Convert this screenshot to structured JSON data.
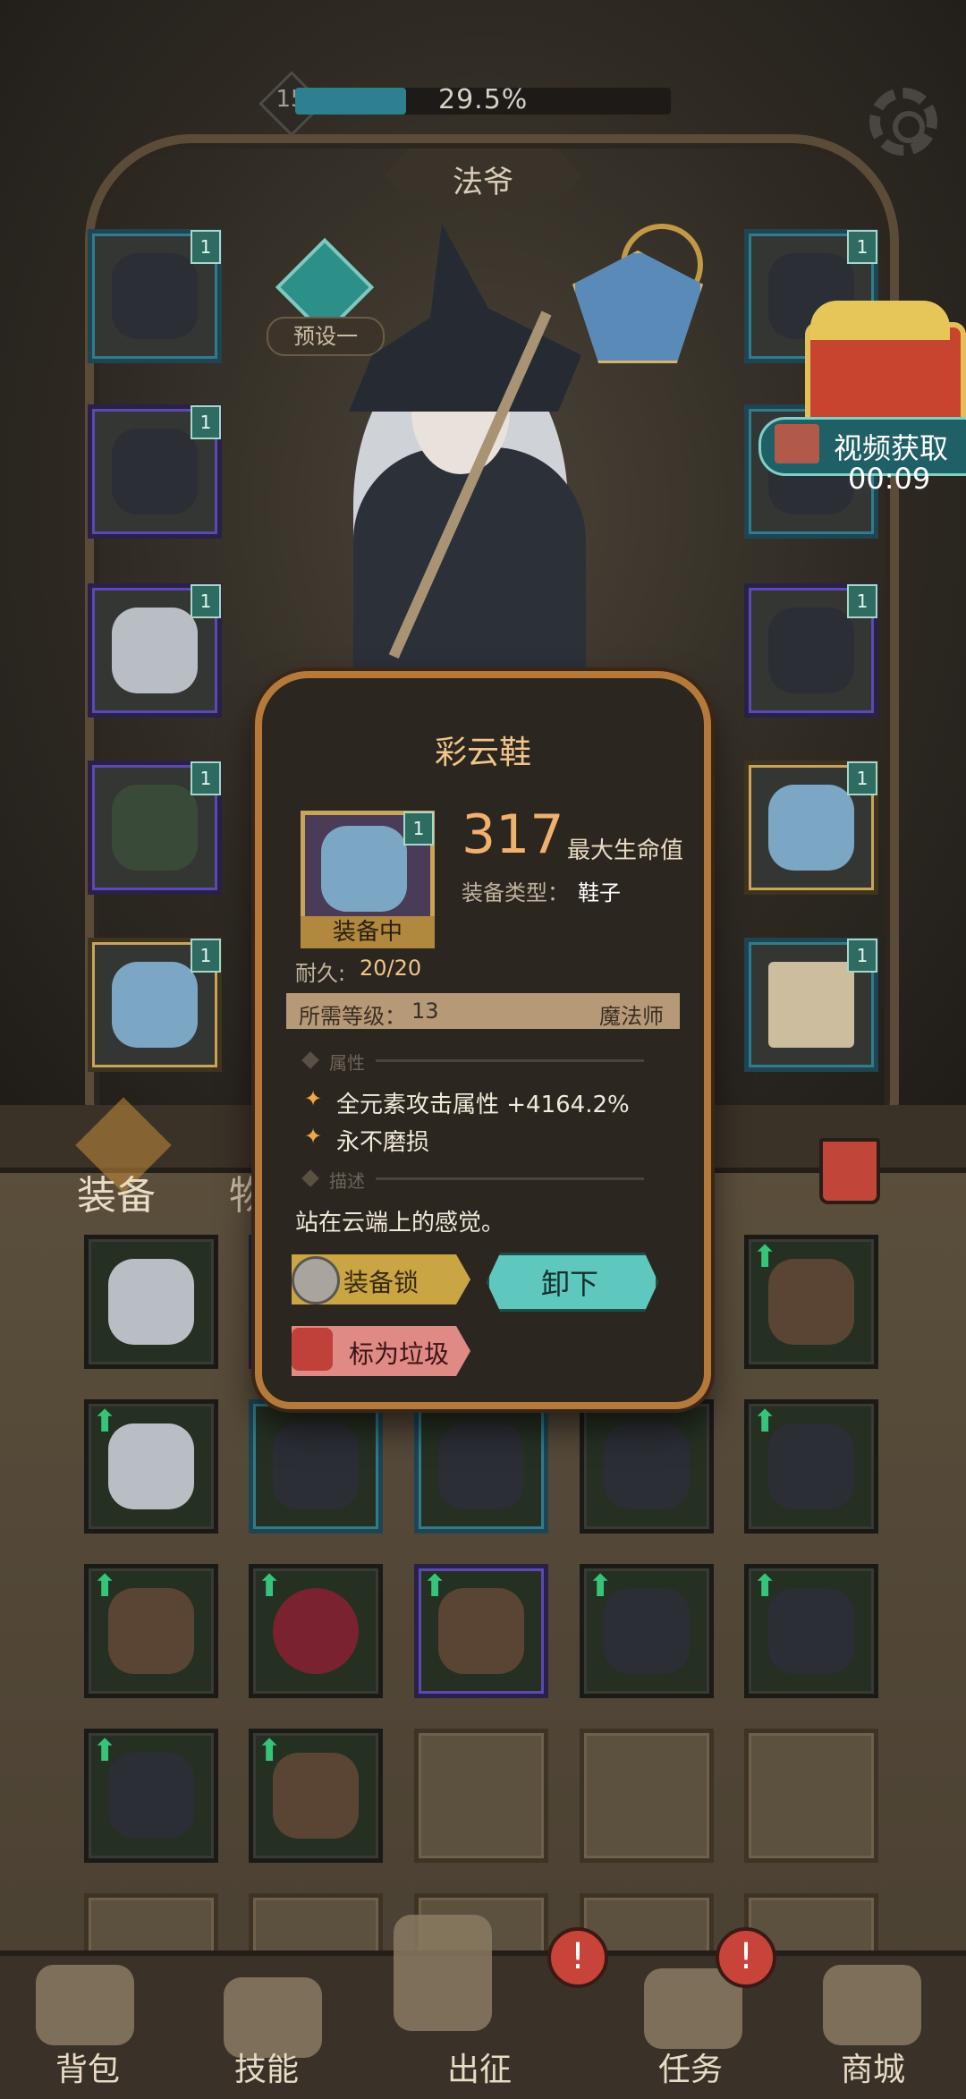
{
  "header": {
    "level": "15",
    "xp_percent_text": "29.5%",
    "xp_fraction": 0.295,
    "settings_icon": "gear-icon",
    "hero_name": "法爷"
  },
  "preset": {
    "label": "预设一"
  },
  "reward": {
    "video_label": "视频获取",
    "timer": "00:09"
  },
  "equipped_left": [
    {
      "name": "hat",
      "tag": "1"
    },
    {
      "name": "robe",
      "tag": "1"
    },
    {
      "name": "gauntlet",
      "tag": "1"
    },
    {
      "name": "belt",
      "tag": "1"
    },
    {
      "name": "boots",
      "tag": "1"
    }
  ],
  "equipped_right": [
    {
      "name": "amulet",
      "tag": "1"
    },
    {
      "name": "cape",
      "tag": "1"
    },
    {
      "name": "ring",
      "tag": "1"
    },
    {
      "name": "staff",
      "tag": "1"
    },
    {
      "name": "scroll",
      "tag": "1"
    }
  ],
  "bag_tabs": {
    "equip": "装备",
    "items": "物品"
  },
  "popup": {
    "title": "彩云鞋",
    "tag": "1",
    "value": "317",
    "stat_name": "最大生命值",
    "type_label": "装备类型：",
    "type_value": "鞋子",
    "equipped_label": "装备中",
    "durability_label": "耐久:",
    "durability_value": "20/20",
    "req_level_label": "所需等级：",
    "req_level_value": "13",
    "req_class": "魔法师",
    "attr_section": "属性",
    "attributes": [
      "全元素攻击属性 +4164.2%",
      "永不磨损"
    ],
    "desc_section": "描述",
    "description": "站在云端上的感觉。",
    "lock_button": "装备锁",
    "unequip_button": "卸下",
    "junk_button": "标为垃圾"
  },
  "nav": {
    "bag": "背包",
    "skills": "技能",
    "expedition": "出征",
    "tasks": "任务",
    "shop": "商城",
    "badge_text": "!"
  }
}
